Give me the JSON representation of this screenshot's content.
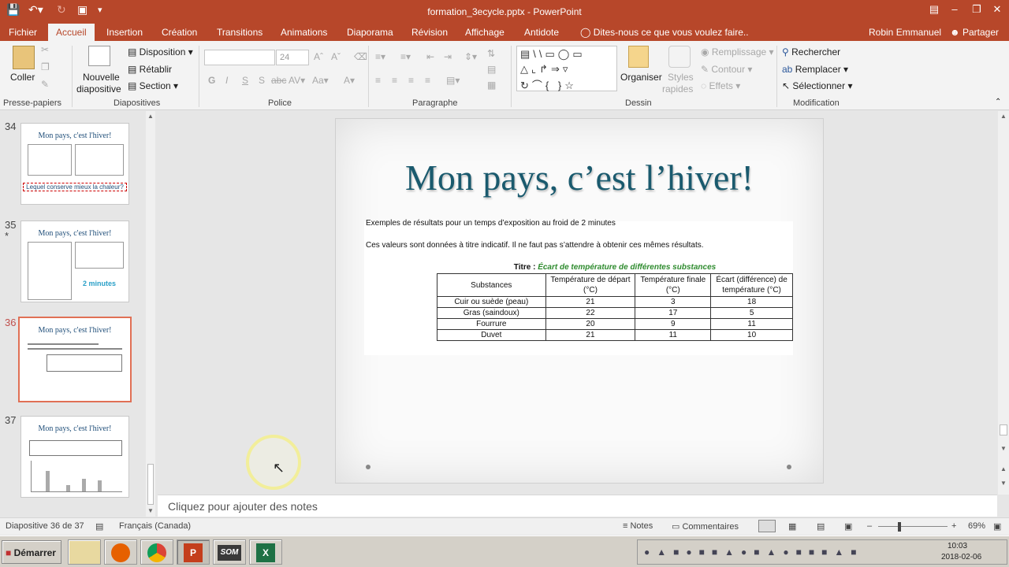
{
  "window": {
    "title": "formation_3ecycle.pptx - PowerPoint",
    "user": "Robin Emmanuel",
    "share_label": "Partager"
  },
  "tabs": [
    "Fichier",
    "Accueil",
    "Insertion",
    "Création",
    "Transitions",
    "Animations",
    "Diaporama",
    "Révision",
    "Affichage",
    "Antidote"
  ],
  "active_tab": "Accueil",
  "tell_me": "Dites-nous ce que vous voulez faire..",
  "ribbon": {
    "clipboard": {
      "paste": "Coller",
      "label": "Presse-papiers"
    },
    "slides": {
      "new_slide_1": "Nouvelle",
      "new_slide_2": "diapositive",
      "layout": "Disposition",
      "reset": "Rétablir",
      "section": "Section",
      "label": "Diapositives"
    },
    "font": {
      "size": "24",
      "label": "Police",
      "bold": "G",
      "italic": "I",
      "underline": "S",
      "shadow": "S",
      "strike": "abc"
    },
    "paragraph": {
      "label": "Paragraphe"
    },
    "drawing": {
      "arrange": "Organiser",
      "quick_styles_1": "Styles",
      "quick_styles_2": "rapides",
      "fill": "Remplissage",
      "outline": "Contour",
      "effects": "Effets",
      "label": "Dessin"
    },
    "editing": {
      "find": "Rechercher",
      "replace": "Remplacer",
      "select": "Sélectionner",
      "label": "Modification"
    }
  },
  "thumbnails": [
    {
      "number": "34",
      "title": "Mon pays, c'est l'hiver!",
      "caption": "Lequel conserve mieux la chaleur?"
    },
    {
      "number": "35",
      "title": "Mon pays, c'est l'hiver!",
      "caption": "2 minutes",
      "star": "*"
    },
    {
      "number": "36",
      "title": "Mon pays, c'est l'hiver!"
    },
    {
      "number": "37",
      "title": "Mon pays, c'est l'hiver!"
    }
  ],
  "slide": {
    "title": "Mon pays, c’est l’hiver!",
    "line1": "Exemples de résultats pour un temps d’exposition au froid de 2 minutes",
    "line2": "Ces valeurs sont données à titre indicatif. Il ne faut pas s’attendre à obtenir ces mêmes résultats.",
    "caption_prefix": "Titre : ",
    "caption_title": "Écart de température de différentes substances",
    "table": {
      "headers": [
        "Substances",
        "Température de départ (°C)",
        "Température finale (°C)",
        "Écart (différence) de température (°C)"
      ],
      "rows": [
        [
          "Cuir ou suède (peau)",
          "21",
          "3",
          "18"
        ],
        [
          "Gras (saindoux)",
          "22",
          "17",
          "5"
        ],
        [
          "Fourrure",
          "20",
          "9",
          "11"
        ],
        [
          "Duvet",
          "21",
          "11",
          "10"
        ]
      ]
    }
  },
  "notes_placeholder": "Cliquez pour ajouter des notes",
  "status": {
    "slide_counter": "Diapositive 36 de 37",
    "language": "Français (Canada)",
    "notes": "Notes",
    "comments": "Commentaires",
    "zoom": "69%"
  },
  "taskbar": {
    "start": "Démarrer",
    "time": "10:03",
    "date": "2018-02-06"
  },
  "colors": {
    "accent": "#b7472a",
    "slide_title": "#1a5a6e",
    "caption_green": "#2e8b2e"
  }
}
